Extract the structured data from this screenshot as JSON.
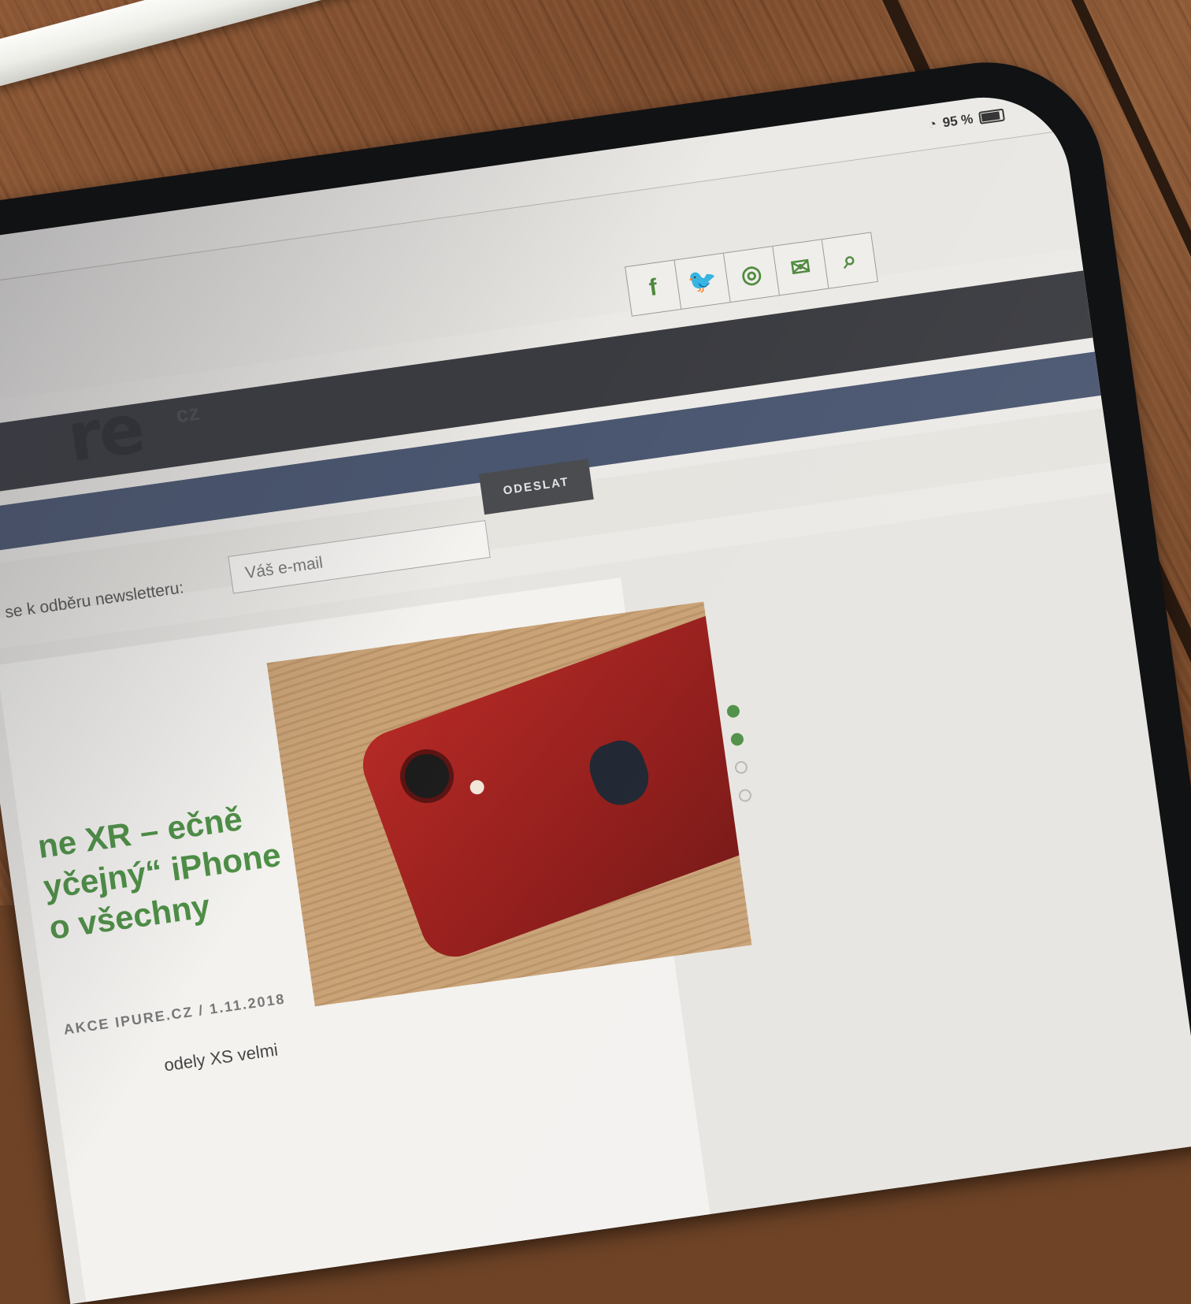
{
  "status": {
    "battery_text": "95 %",
    "battery_level": 0.95
  },
  "site": {
    "logo_text": "re",
    "logo_suffix": "cz"
  },
  "social": {
    "icons": [
      "facebook-icon",
      "twitter-icon",
      "instagram-icon",
      "mail-icon",
      "search-icon"
    ],
    "glyphs": [
      "f",
      "🐦",
      "◎",
      "✉",
      "⌕"
    ]
  },
  "newsletter": {
    "label": "se k odběru newsletteru:",
    "placeholder": "Váš e-mail",
    "button": "ODESLAT"
  },
  "article": {
    "headline": "ne XR – ečně yčejný“ iPhone o všechny",
    "meta": "AKCE IPURE.CZ / 1.11.2018",
    "excerpt": "odely XS velmi"
  },
  "slider": {
    "active_index": 1,
    "count": 4
  },
  "colors": {
    "accent_green": "#4e8f46",
    "dark_bar": "#3a3b40",
    "blue_bar": "#4a5670"
  }
}
